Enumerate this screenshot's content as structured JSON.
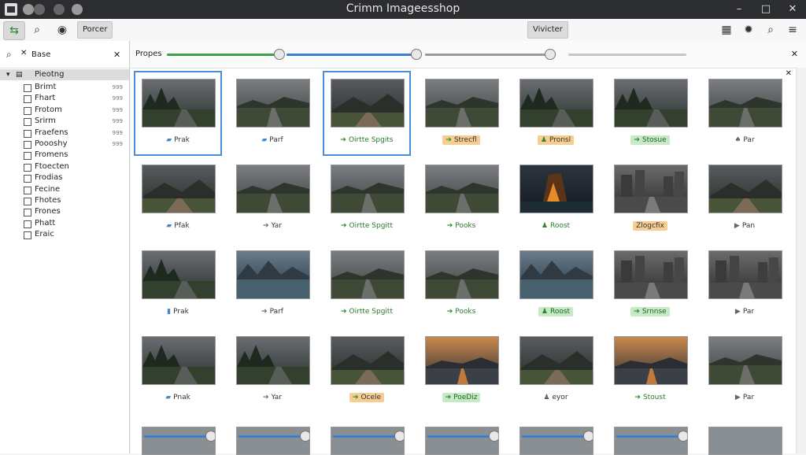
{
  "window": {
    "title": "Crimm Imageesshop",
    "controls": {
      "minimize": "–",
      "maximize": "□",
      "close": "✕"
    }
  },
  "toolbar": {
    "left_buttons": [
      {
        "icon": "green-arrows-icon",
        "glyph": "⇆"
      },
      {
        "icon": "search-icon",
        "glyph": "⌕"
      },
      {
        "icon": "eye-icon",
        "glyph": "◉"
      }
    ],
    "pressed_label": "Porcer",
    "center_label": "Vivicter",
    "right_buttons": [
      {
        "icon": "grid-icon",
        "glyph": "▦"
      },
      {
        "icon": "gear-icon",
        "glyph": "✹"
      },
      {
        "icon": "search-icon",
        "glyph": "⌕"
      },
      {
        "icon": "menu-icon",
        "glyph": "≡"
      }
    ]
  },
  "sidebar": {
    "search_value": "Base",
    "close_glyph": "✕",
    "tree_root": "Pieotng",
    "items": [
      {
        "label": "Brimt",
        "count": "999"
      },
      {
        "label": "Fhart",
        "count": "999"
      },
      {
        "label": "Frotom",
        "count": "999"
      },
      {
        "label": "Srirm",
        "count": "999"
      },
      {
        "label": "Fraefens",
        "count": "999"
      },
      {
        "label": "Poooshy",
        "count": "999"
      },
      {
        "label": "Fromens",
        "count": ""
      },
      {
        "label": "Ftoecten",
        "count": ""
      },
      {
        "label": "Frodias",
        "count": ""
      },
      {
        "label": "Fecine",
        "count": ""
      },
      {
        "label": "Fhotes",
        "count": ""
      },
      {
        "label": "Frones",
        "count": ""
      },
      {
        "label": "Phatt",
        "count": ""
      },
      {
        "label": "Eraic",
        "count": ""
      }
    ]
  },
  "properties": {
    "label": "Propes",
    "close_glyph": "✕",
    "sliders": [
      {
        "value": 1.0,
        "color": "#3aa34a"
      },
      {
        "value": 1.0,
        "color": "#3a7fd0"
      },
      {
        "value": 0.99,
        "color": "#9a9a9a"
      },
      {
        "value": 0.0,
        "color": "#b5b5b5"
      }
    ]
  },
  "grid": {
    "close_glyph": "✕",
    "rows": [
      [
        {
          "caption": "Prak",
          "icon": "folder-icon",
          "style": "plain",
          "theme": "forest"
        },
        {
          "caption": "Parf",
          "icon": "folder-icon",
          "style": "plain",
          "theme": "road"
        },
        {
          "caption": "Oirtte Spgits",
          "icon": "arrow-icon",
          "style": "greentext",
          "theme": "hill"
        },
        {
          "caption": "Strecfl",
          "icon": "arrow-icon",
          "style": "orange",
          "theme": "road"
        },
        {
          "caption": "Pronsl",
          "icon": "person-icon",
          "style": "orange",
          "theme": "forest"
        },
        {
          "caption": "Stosue",
          "icon": "arrow-icon",
          "style": "green",
          "theme": "forest"
        },
        {
          "caption": "Par",
          "icon": "tree-icon",
          "style": "plain",
          "theme": "road"
        }
      ],
      [
        {
          "caption": "Pfak",
          "icon": "folder-icon",
          "style": "plain",
          "theme": "hill"
        },
        {
          "caption": "Yar",
          "icon": "arrow-icon",
          "style": "plain",
          "theme": "road"
        },
        {
          "caption": "Oirtte Spgitt",
          "icon": "arrow-icon",
          "style": "greentext",
          "theme": "road"
        },
        {
          "caption": "Pooks",
          "icon": "arrow-icon",
          "style": "greentext",
          "theme": "road"
        },
        {
          "caption": "Roost",
          "icon": "person-icon",
          "style": "greentext",
          "theme": "fire"
        },
        {
          "caption": "Zlogcfix",
          "icon": "",
          "style": "orange",
          "theme": "city"
        },
        {
          "caption": "Pan",
          "icon": "play-icon",
          "style": "plain",
          "theme": "hill"
        }
      ],
      [
        {
          "caption": "Prak",
          "icon": "doc-icon",
          "style": "plain",
          "theme": "forest"
        },
        {
          "caption": "Parf",
          "icon": "arrow-icon",
          "style": "plain",
          "theme": "lake"
        },
        {
          "caption": "Oirtte Spgitt",
          "icon": "arrow-icon",
          "style": "greentext",
          "theme": "road"
        },
        {
          "caption": "Pooks",
          "icon": "arrow-icon",
          "style": "greentext",
          "theme": "road"
        },
        {
          "caption": "Roost",
          "icon": "person-icon",
          "style": "green",
          "theme": "lake"
        },
        {
          "caption": "Srnnse",
          "icon": "arrow-icon",
          "style": "green",
          "theme": "city"
        },
        {
          "caption": "Par",
          "icon": "play-icon",
          "style": "plain",
          "theme": "city"
        }
      ],
      [
        {
          "caption": "Pnak",
          "icon": "folder-icon",
          "style": "plain",
          "theme": "forest"
        },
        {
          "caption": "Yar",
          "icon": "arrow-icon",
          "style": "plain",
          "theme": "forest"
        },
        {
          "caption": "Ocele",
          "icon": "arrow-icon",
          "style": "orange",
          "theme": "hill"
        },
        {
          "caption": "PoeDiz",
          "icon": "arrow-icon",
          "style": "green",
          "theme": "sunset"
        },
        {
          "caption": "eyor",
          "icon": "person-icon",
          "style": "plain",
          "theme": "hill"
        },
        {
          "caption": "Stoust",
          "icon": "arrow-icon",
          "style": "greentext",
          "theme": "sunset"
        },
        {
          "caption": "Par",
          "icon": "play-icon",
          "style": "plain",
          "theme": "road"
        }
      ]
    ]
  }
}
